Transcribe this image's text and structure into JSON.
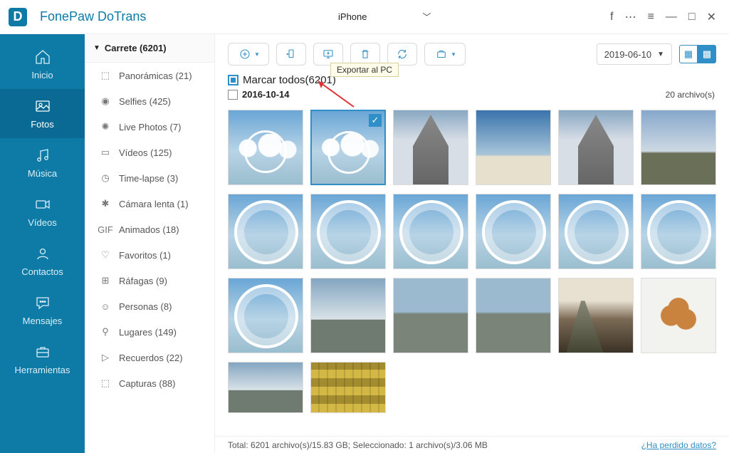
{
  "app": {
    "title": "FonePaw DoTrans",
    "device": "iPhone"
  },
  "win": {
    "fb": "f",
    "chat": "💬",
    "menu": "≡",
    "min": "—",
    "max": "□",
    "close": "✕"
  },
  "sidebar": {
    "items": [
      {
        "label": "Inicio"
      },
      {
        "label": "Fotos"
      },
      {
        "label": "Música"
      },
      {
        "label": "Vídeos"
      },
      {
        "label": "Contactos"
      },
      {
        "label": "Mensajes"
      },
      {
        "label": "Herramientas"
      }
    ]
  },
  "albums": {
    "root": "Carrete (6201)",
    "items": [
      {
        "icon": "⬚",
        "label": "Panorámicas (21)"
      },
      {
        "icon": "◉",
        "label": "Selfies (425)"
      },
      {
        "icon": "✺",
        "label": "Live Photos (7)"
      },
      {
        "icon": "▭",
        "label": "Vídeos (125)"
      },
      {
        "icon": "◷",
        "label": "Time-lapse (3)"
      },
      {
        "icon": "✱",
        "label": "Cámara lenta (1)"
      },
      {
        "icon": "GIF",
        "label": "Animados (18)"
      },
      {
        "icon": "♡",
        "label": "Favoritos (1)"
      },
      {
        "icon": "⊞",
        "label": "Ráfagas (9)"
      },
      {
        "icon": "☺",
        "label": "Personas (8)"
      },
      {
        "icon": "⚲",
        "label": "Lugares (149)"
      },
      {
        "icon": "▷",
        "label": "Recuerdos (22)"
      },
      {
        "icon": "⬚",
        "label": "Capturas (88)"
      }
    ]
  },
  "toolbar": {
    "tooltip": "Exportar al PC",
    "date": "2019-06-10"
  },
  "content": {
    "select_all": "Marcar todos(6201)",
    "group_date": "2016-10-14",
    "group_count": "20 archivo(s)"
  },
  "status": {
    "summary": "Total: 6201 archivo(s)/15.83 GB; Seleccionado: 1 archivo(s)/3.06 MB",
    "lost": "¿Ha perdido datos?"
  }
}
